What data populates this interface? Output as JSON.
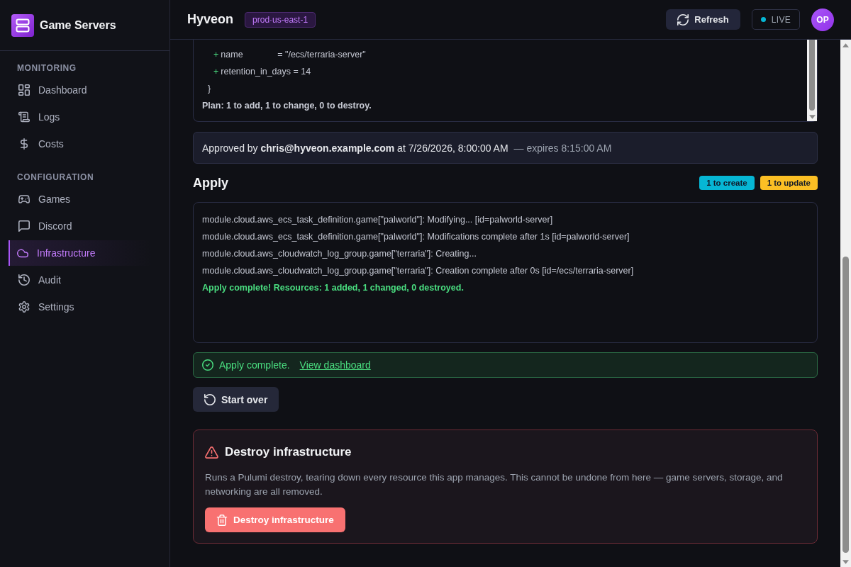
{
  "sidebar": {
    "app_name": "Game Servers",
    "sections": [
      {
        "title": "MONITORING",
        "items": [
          {
            "label": "Dashboard",
            "selected": false
          },
          {
            "label": "Logs",
            "selected": false
          },
          {
            "label": "Costs",
            "selected": false
          }
        ]
      },
      {
        "title": "CONFIGURATION",
        "items": [
          {
            "label": "Games",
            "selected": false
          },
          {
            "label": "Discord",
            "selected": false
          },
          {
            "label": "Infrastructure",
            "selected": true
          },
          {
            "label": "Audit",
            "selected": false
          },
          {
            "label": "Settings",
            "selected": false
          }
        ]
      }
    ]
  },
  "header": {
    "title": "Hyveon",
    "environment": "prod·us-east-1",
    "refresh_button": "Refresh",
    "live": {
      "label": "LIVE",
      "connected": true
    },
    "avatar": "OP"
  },
  "plan": {
    "lines": [
      {
        "kind": "added",
        "marker": "+",
        "text": "name              = \"/ecs/terraria-server\""
      },
      {
        "kind": "added",
        "marker": "+",
        "text": "retention_in_days = 14"
      },
      {
        "kind": "close",
        "text": "}"
      },
      {
        "kind": "summary",
        "text": "Plan: 1 to add, 1 to change, 0 to destroy."
      }
    ]
  },
  "approval": {
    "text": "Approved by **chris@hyveon.example.com** at 7/26/2026, 8:00:00 AM",
    "expiry": "— expires 8:15:00 AM"
  },
  "apply": {
    "title": "Apply",
    "badges": [
      {
        "label": "1 to create",
        "color": "#06b6d4"
      },
      {
        "label": "1 to update",
        "color": "#fbbf24"
      }
    ],
    "log": [
      {
        "kind": "info",
        "text": "module.cloud.aws_ecs_task_definition.game[\"palworld\"]: Modifying... [id=palworld-server]"
      },
      {
        "kind": "info",
        "text": "module.cloud.aws_ecs_task_definition.game[\"palworld\"]: Modifications complete after 1s [id=palworld-server]"
      },
      {
        "kind": "info",
        "text": "module.cloud.aws_cloudwatch_log_group.game[\"terraria\"]: Creating..."
      },
      {
        "kind": "info",
        "text": "module.cloud.aws_cloudwatch_log_group.game[\"terraria\"]: Creation complete after 0s [id=/ecs/terraria-server]"
      },
      {
        "kind": "success",
        "text": "Apply complete! Resources: 1 added, 1 changed, 0 destroyed."
      }
    ]
  },
  "alert": {
    "message": "Apply complete.",
    "link": "View dashboard"
  },
  "start_over_button": "Start over",
  "danger_zone": {
    "title": "Destroy infrastructure",
    "description": "Runs a Pulumi destroy, tearing down every resource this app manages. This cannot be undone from here — game servers, storage, and networking are all removed.",
    "button": "Destroy infrastructure"
  }
}
